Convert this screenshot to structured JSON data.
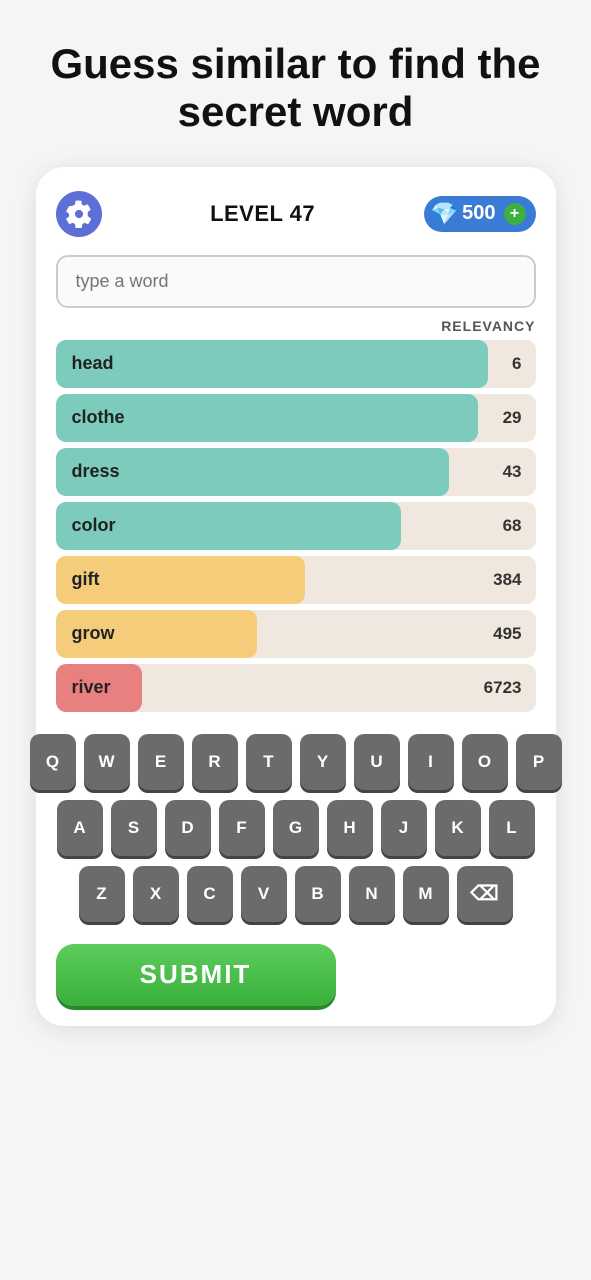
{
  "page": {
    "title": "Guess similar to find the secret word"
  },
  "header": {
    "level_label": "LEVEL 47",
    "gems_count": "500"
  },
  "input": {
    "placeholder": "type a word"
  },
  "relevancy_label": "RELEVANCY",
  "words": [
    {
      "word": "head",
      "score": "6",
      "bar_pct": 90,
      "color": "#7dcbbc"
    },
    {
      "word": "clothe",
      "score": "29",
      "bar_pct": 88,
      "color": "#7dcbbc"
    },
    {
      "word": "dress",
      "score": "43",
      "bar_pct": 82,
      "color": "#7dcbbc"
    },
    {
      "word": "color",
      "score": "68",
      "bar_pct": 72,
      "color": "#7dcbbc"
    },
    {
      "word": "gift",
      "score": "384",
      "bar_pct": 52,
      "color": "#f5cc7a"
    },
    {
      "word": "grow",
      "score": "495",
      "bar_pct": 42,
      "color": "#f5cc7a"
    },
    {
      "word": "river",
      "score": "6723",
      "bar_pct": 18,
      "color": "#e88080"
    }
  ],
  "keyboard": {
    "row1": [
      "Q",
      "W",
      "E",
      "R",
      "T",
      "Y",
      "U",
      "I",
      "O",
      "P"
    ],
    "row2": [
      "A",
      "S",
      "D",
      "F",
      "G",
      "H",
      "J",
      "K",
      "L"
    ],
    "row3": [
      "Z",
      "X",
      "C",
      "V",
      "B",
      "N",
      "M",
      "⌫"
    ]
  },
  "submit_label": "SUBMIT",
  "icons": {
    "gear": "⚙",
    "gem": "💎",
    "plus": "+"
  }
}
